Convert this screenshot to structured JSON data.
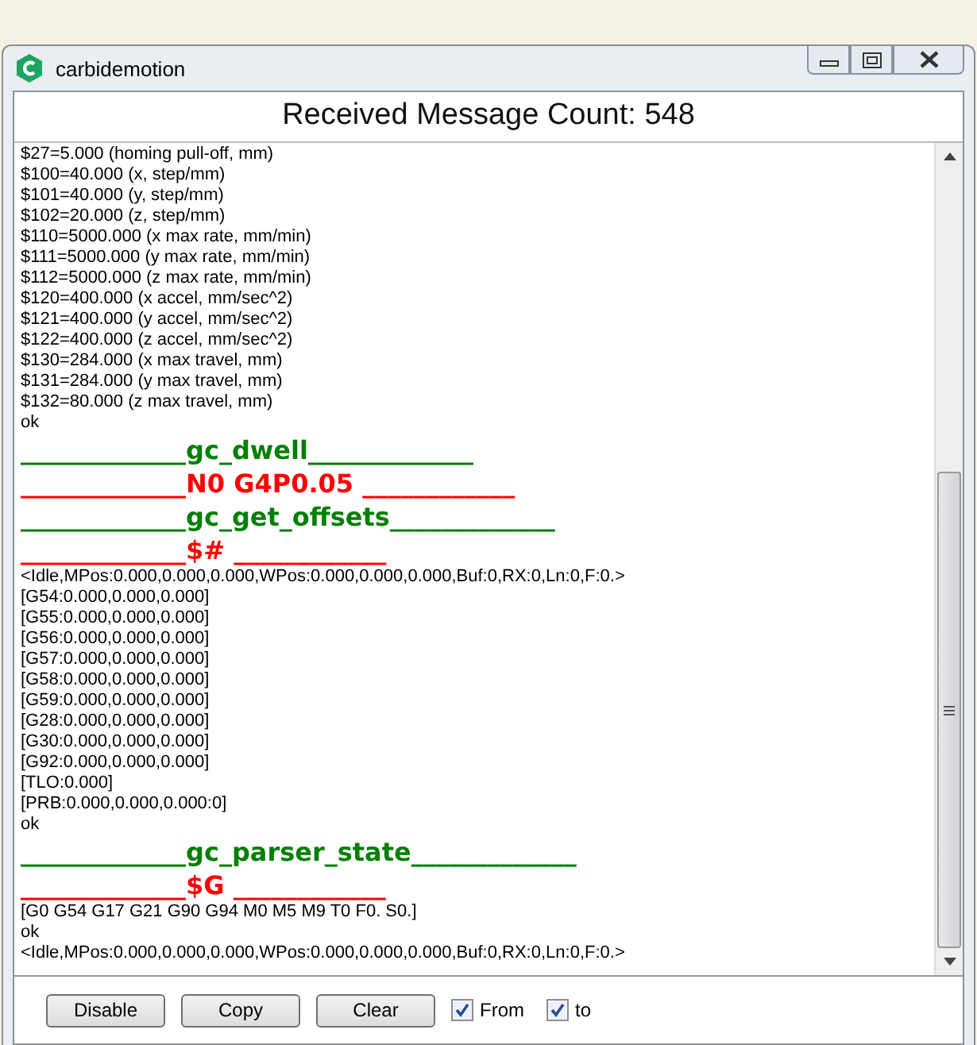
{
  "window": {
    "title": "carbidemotion"
  },
  "header": {
    "text": "Received Message Count: 548"
  },
  "log": [
    {
      "kind": "text",
      "text": "$27=5.000 (homing pull-off, mm)"
    },
    {
      "kind": "text",
      "text": "$100=40.000 (x, step/mm)"
    },
    {
      "kind": "text",
      "text": "$101=40.000 (y, step/mm)"
    },
    {
      "kind": "text",
      "text": "$102=20.000 (z, step/mm)"
    },
    {
      "kind": "text",
      "text": "$110=5000.000 (x max rate, mm/min)"
    },
    {
      "kind": "text",
      "text": "$111=5000.000 (y max rate, mm/min)"
    },
    {
      "kind": "text",
      "text": "$112=5000.000 (z max rate, mm/min)"
    },
    {
      "kind": "text",
      "text": "$120=400.000 (x accel, mm/sec^2)"
    },
    {
      "kind": "text",
      "text": "$121=400.000 (y accel, mm/sec^2)"
    },
    {
      "kind": "text",
      "text": "$122=400.000 (z accel, mm/sec^2)"
    },
    {
      "kind": "text",
      "text": "$130=284.000 (x max travel, mm)"
    },
    {
      "kind": "text",
      "text": "$131=284.000 (y max travel, mm)"
    },
    {
      "kind": "text",
      "text": "$132=80.000 (z max travel, mm)"
    },
    {
      "kind": "text",
      "text": "ok"
    },
    {
      "kind": "heading",
      "color": "#008000",
      "text": "_____________gc_dwell_____________"
    },
    {
      "kind": "heading",
      "color": "#ff0000",
      "text": "_____________N0 G4P0.05 ____________"
    },
    {
      "kind": "heading",
      "color": "#008000",
      "text": "_____________gc_get_offsets_____________"
    },
    {
      "kind": "heading",
      "color": "#ff0000",
      "text": "_____________$# ____________"
    },
    {
      "kind": "text",
      "text": "<Idle,MPos:0.000,0.000,0.000,WPos:0.000,0.000,0.000,Buf:0,RX:0,Ln:0,F:0.>"
    },
    {
      "kind": "text",
      "text": "[G54:0.000,0.000,0.000]"
    },
    {
      "kind": "text",
      "text": "[G55:0.000,0.000,0.000]"
    },
    {
      "kind": "text",
      "text": "[G56:0.000,0.000,0.000]"
    },
    {
      "kind": "text",
      "text": "[G57:0.000,0.000,0.000]"
    },
    {
      "kind": "text",
      "text": "[G58:0.000,0.000,0.000]"
    },
    {
      "kind": "text",
      "text": "[G59:0.000,0.000,0.000]"
    },
    {
      "kind": "text",
      "text": "[G28:0.000,0.000,0.000]"
    },
    {
      "kind": "text",
      "text": "[G30:0.000,0.000,0.000]"
    },
    {
      "kind": "text",
      "text": "[G92:0.000,0.000,0.000]"
    },
    {
      "kind": "text",
      "text": "[TLO:0.000]"
    },
    {
      "kind": "text",
      "text": "[PRB:0.000,0.000,0.000:0]"
    },
    {
      "kind": "text",
      "text": "ok"
    },
    {
      "kind": "heading",
      "color": "#008000",
      "text": "_____________gc_parser_state_____________"
    },
    {
      "kind": "heading",
      "color": "#ff0000",
      "text": "_____________$G ____________"
    },
    {
      "kind": "text",
      "text": "[G0 G54 G17 G21 G90 G94 M0 M5 M9 T0 F0. S0.]"
    },
    {
      "kind": "text",
      "text": "ok"
    },
    {
      "kind": "text",
      "text": "<Idle,MPos:0.000,0.000,0.000,WPos:0.000,0.000,0.000,Buf:0,RX:0,Ln:0,F:0.>"
    }
  ],
  "buttons": [
    "Disable",
    "Copy",
    "Clear"
  ],
  "checkboxes": [
    {
      "label": "From",
      "checked": true
    },
    {
      "label": "to",
      "checked": true
    }
  ]
}
